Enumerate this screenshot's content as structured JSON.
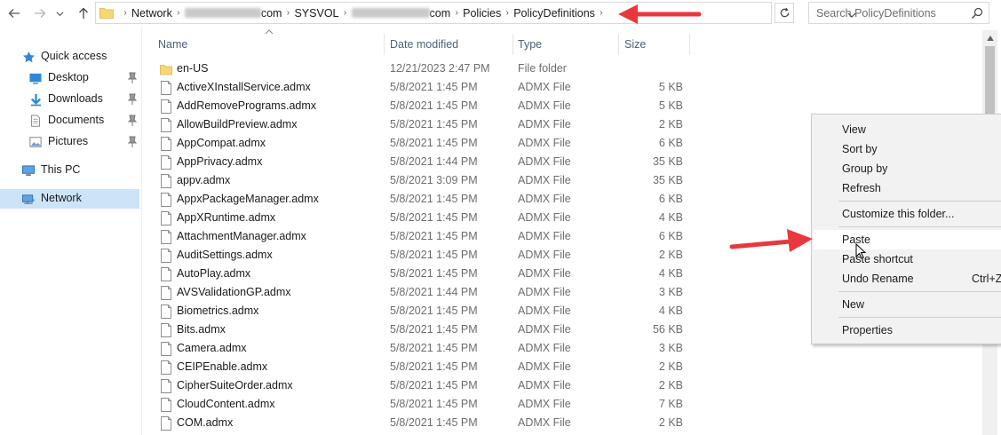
{
  "address_bar": {
    "crumbs": [
      "Network",
      "com",
      "SYSVOL",
      "com",
      "Policies",
      "PolicyDefinitions"
    ]
  },
  "search": {
    "placeholder": "Search PolicyDefinitions"
  },
  "nav_pane": {
    "items": [
      {
        "label": "Quick access",
        "icon": "star-icon"
      },
      {
        "label": "Desktop",
        "icon": "desktop-icon",
        "pinned": true
      },
      {
        "label": "Downloads",
        "icon": "download-icon",
        "pinned": true
      },
      {
        "label": "Documents",
        "icon": "document-icon",
        "pinned": true
      },
      {
        "label": "Pictures",
        "icon": "picture-icon",
        "pinned": true
      },
      {
        "label": "This PC",
        "icon": "computer-icon"
      },
      {
        "label": "Network",
        "icon": "network-icon",
        "selected": true
      }
    ]
  },
  "columns": {
    "name": "Name",
    "date": "Date modified",
    "type": "Type",
    "size": "Size"
  },
  "files": [
    {
      "name": "en-US",
      "date": "12/21/2023 2:47 PM",
      "type": "File folder",
      "size": "",
      "folder": true
    },
    {
      "name": "ActiveXInstallService.admx",
      "date": "5/8/2021 1:45 PM",
      "type": "ADMX File",
      "size": "5 KB"
    },
    {
      "name": "AddRemovePrograms.admx",
      "date": "5/8/2021 1:45 PM",
      "type": "ADMX File",
      "size": "5 KB"
    },
    {
      "name": "AllowBuildPreview.admx",
      "date": "5/8/2021 1:45 PM",
      "type": "ADMX File",
      "size": "2 KB"
    },
    {
      "name": "AppCompat.admx",
      "date": "5/8/2021 1:45 PM",
      "type": "ADMX File",
      "size": "6 KB"
    },
    {
      "name": "AppPrivacy.admx",
      "date": "5/8/2021 1:44 PM",
      "type": "ADMX File",
      "size": "35 KB"
    },
    {
      "name": "appv.admx",
      "date": "5/8/2021 3:09 PM",
      "type": "ADMX File",
      "size": "35 KB"
    },
    {
      "name": "AppxPackageManager.admx",
      "date": "5/8/2021 1:45 PM",
      "type": "ADMX File",
      "size": "6 KB"
    },
    {
      "name": "AppXRuntime.admx",
      "date": "5/8/2021 1:45 PM",
      "type": "ADMX File",
      "size": "4 KB"
    },
    {
      "name": "AttachmentManager.admx",
      "date": "5/8/2021 1:45 PM",
      "type": "ADMX File",
      "size": "6 KB"
    },
    {
      "name": "AuditSettings.admx",
      "date": "5/8/2021 1:45 PM",
      "type": "ADMX File",
      "size": "2 KB"
    },
    {
      "name": "AutoPlay.admx",
      "date": "5/8/2021 1:45 PM",
      "type": "ADMX File",
      "size": "4 KB"
    },
    {
      "name": "AVSValidationGP.admx",
      "date": "5/8/2021 1:44 PM",
      "type": "ADMX File",
      "size": "3 KB"
    },
    {
      "name": "Biometrics.admx",
      "date": "5/8/2021 1:45 PM",
      "type": "ADMX File",
      "size": "4 KB"
    },
    {
      "name": "Bits.admx",
      "date": "5/8/2021 1:45 PM",
      "type": "ADMX File",
      "size": "56 KB"
    },
    {
      "name": "Camera.admx",
      "date": "5/8/2021 1:45 PM",
      "type": "ADMX File",
      "size": "3 KB"
    },
    {
      "name": "CEIPEnable.admx",
      "date": "5/8/2021 1:45 PM",
      "type": "ADMX File",
      "size": "2 KB"
    },
    {
      "name": "CipherSuiteOrder.admx",
      "date": "5/8/2021 1:45 PM",
      "type": "ADMX File",
      "size": "2 KB"
    },
    {
      "name": "CloudContent.admx",
      "date": "5/8/2021 1:45 PM",
      "type": "ADMX File",
      "size": "7 KB"
    },
    {
      "name": "COM.admx",
      "date": "5/8/2021 1:45 PM",
      "type": "ADMX File",
      "size": "2 KB"
    }
  ],
  "context_menu": {
    "view": "View",
    "sort_by": "Sort by",
    "group_by": "Group by",
    "refresh": "Refresh",
    "customize": "Customize this folder...",
    "paste": "Paste",
    "paste_shortcut": "Paste shortcut",
    "undo_rename": "Undo Rename",
    "undo_shortcut": "Ctrl+Z",
    "new": "New",
    "properties": "Properties"
  },
  "colors": {
    "selection": "#cce4f7",
    "annotation_arrow": "#e8383d",
    "folder": "#f8d775"
  }
}
